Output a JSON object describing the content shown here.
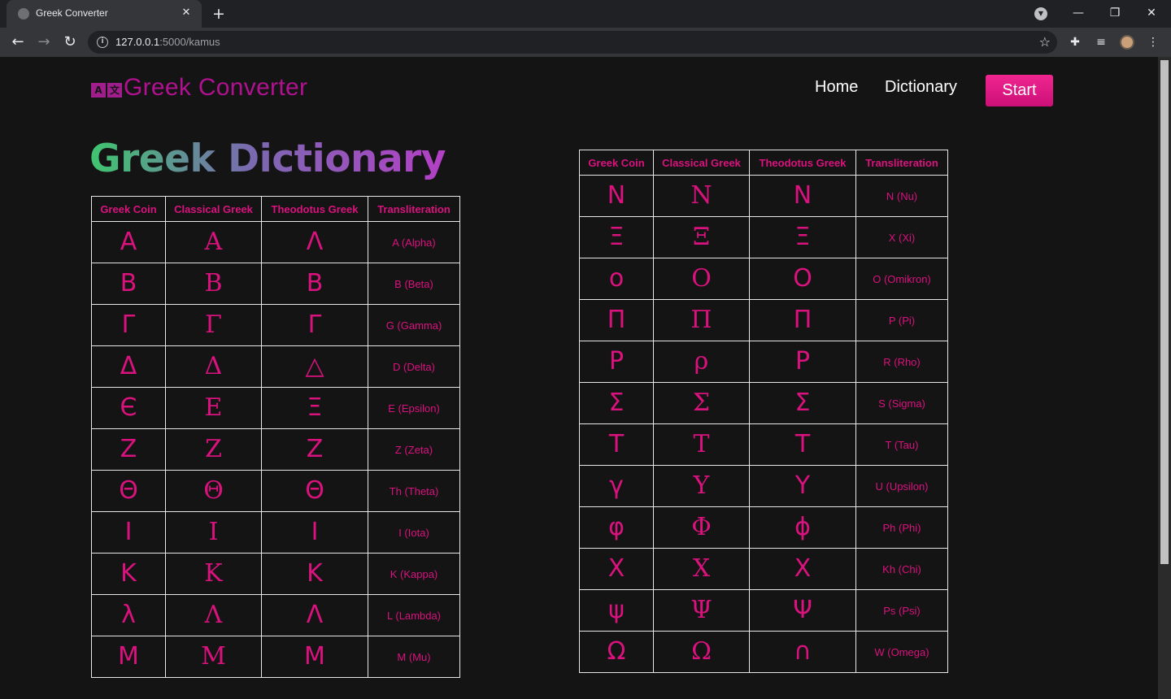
{
  "browser": {
    "tab_title": "Greek Converter",
    "url_host": "127.0.0.1",
    "url_path": ":5000/kamus"
  },
  "site": {
    "logo_left": "A",
    "logo_right": "文",
    "brand": "Greek Converter",
    "nav": {
      "home": "Home",
      "dictionary": "Dictionary",
      "start": "Start"
    },
    "page_title": "Greek Dictionary"
  },
  "table_headers": [
    "Greek Coin",
    "Classical Greek",
    "Theodotus Greek",
    "Transliteration"
  ],
  "letters_left": [
    {
      "coin": "Α",
      "classical": "Α",
      "theodotus": "Λ",
      "translit": "A (Alpha)"
    },
    {
      "coin": "Β",
      "classical": "Β",
      "theodotus": "Β",
      "translit": "B (Beta)"
    },
    {
      "coin": "Γ",
      "classical": "Γ",
      "theodotus": "Γ",
      "translit": "G (Gamma)"
    },
    {
      "coin": "Δ",
      "classical": "Δ",
      "theodotus": "△",
      "translit": "D (Delta)"
    },
    {
      "coin": "Є",
      "classical": "Ε",
      "theodotus": "Ξ",
      "translit": "E (Epsilon)"
    },
    {
      "coin": "Ζ",
      "classical": "Ζ",
      "theodotus": "Ζ",
      "translit": "Z (Zeta)"
    },
    {
      "coin": "Θ",
      "classical": "Θ",
      "theodotus": "Θ",
      "translit": "Th (Theta)"
    },
    {
      "coin": "Ι",
      "classical": "Ι",
      "theodotus": "Ι",
      "translit": "I (Iota)"
    },
    {
      "coin": "Κ",
      "classical": "Κ",
      "theodotus": "Κ",
      "translit": "K (Kappa)"
    },
    {
      "coin": "λ",
      "classical": "Λ",
      "theodotus": "Λ",
      "translit": "L (Lambda)"
    },
    {
      "coin": "Μ",
      "classical": "Μ",
      "theodotus": "Μ",
      "translit": "M (Mu)"
    }
  ],
  "letters_right": [
    {
      "coin": "Ν",
      "classical": "Ν",
      "theodotus": "Ν",
      "translit": "N (Nu)"
    },
    {
      "coin": "Ξ",
      "classical": "Ξ",
      "theodotus": "Ξ",
      "translit": "X (Xi)"
    },
    {
      "coin": "ο",
      "classical": "Ο",
      "theodotus": "Ο",
      "translit": "O (Omikron)"
    },
    {
      "coin": "Π",
      "classical": "Π",
      "theodotus": "Π",
      "translit": "P (Pi)"
    },
    {
      "coin": "Ρ",
      "classical": "ρ",
      "theodotus": "Ρ",
      "translit": "R (Rho)"
    },
    {
      "coin": "Σ",
      "classical": "Σ",
      "theodotus": "Σ",
      "translit": "S (Sigma)"
    },
    {
      "coin": "Τ",
      "classical": "Τ",
      "theodotus": "Τ",
      "translit": "T (Tau)"
    },
    {
      "coin": "γ",
      "classical": "Υ",
      "theodotus": "Υ",
      "translit": "U (Upsilon)"
    },
    {
      "coin": "φ",
      "classical": "Φ",
      "theodotus": "ϕ",
      "translit": "Ph (Phi)"
    },
    {
      "coin": "Χ",
      "classical": "Χ",
      "theodotus": "Χ",
      "translit": "Kh (Chi)"
    },
    {
      "coin": "ψ",
      "classical": "Ψ",
      "theodotus": "Ψ",
      "translit": "Ps (Psi)"
    },
    {
      "coin": "Ω",
      "classical": "Ω",
      "theodotus": "∩",
      "translit": "W (Omega)"
    }
  ]
}
